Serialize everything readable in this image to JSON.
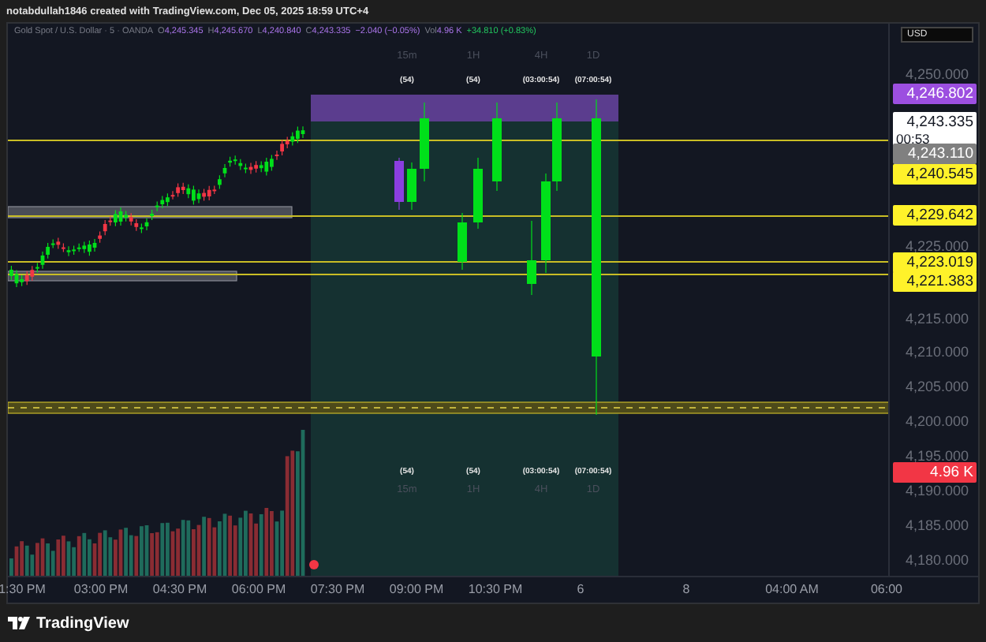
{
  "header": {
    "caption": "notabdullah1846 created with TradingView.com, Dec 05, 2025 18:59 UTC+4"
  },
  "legend": {
    "symbol": "Gold Spot / U.S. Dollar · 5 · OANDA",
    "values": [
      {
        "key": "O",
        "value": "4,245.345"
      },
      {
        "key": "H",
        "value": "4,245.670"
      },
      {
        "key": "L",
        "value": "4,240.840"
      },
      {
        "key": "C",
        "value": "4,243.335"
      }
    ],
    "change": "−2.040 (−0.05%)",
    "volume": {
      "key": "Vol",
      "value": "4.96 K"
    },
    "indicator": "+34.810 (+0.83%)"
  },
  "currency_button": "USD",
  "timeframes_top": [
    {
      "label": "15m",
      "countdown": "(54)"
    },
    {
      "label": "1H",
      "countdown": "(54)"
    },
    {
      "label": "4H",
      "countdown": "(03:00:54)"
    },
    {
      "label": "1D",
      "countdown": "(07:00:54)"
    }
  ],
  "timeframes_bottom": [
    {
      "label": "15m",
      "countdown": "(54)"
    },
    {
      "label": "1H",
      "countdown": "(54)"
    },
    {
      "label": "4H",
      "countdown": "(03:00:54)"
    },
    {
      "label": "1D",
      "countdown": "(07:00:54)"
    }
  ],
  "price_axis": {
    "ticks": [
      "4,250.000",
      "4,225.000",
      "4,215.000",
      "4,210.000",
      "4,205.000",
      "4,200.000",
      "4,195.000",
      "4,190.000",
      "4,185.000",
      "4,180.000"
    ]
  },
  "price_labels": [
    {
      "kind": "high",
      "text": "4,246.802"
    },
    {
      "kind": "last",
      "text": "4,243.335",
      "timer": "00:53"
    },
    {
      "kind": "prev",
      "text": "4,243.110"
    },
    {
      "kind": "level",
      "text": "4,240.545"
    },
    {
      "kind": "level",
      "text": "4,229.642"
    },
    {
      "kind": "level",
      "text": "4,223.019"
    },
    {
      "kind": "level",
      "text": "4,221.383"
    },
    {
      "kind": "volume",
      "text": "4.96 K"
    }
  ],
  "time_axis": {
    "labels": [
      "1:30 PM",
      "03:00 PM",
      "04:30 PM",
      "06:00 PM",
      "07:30 PM",
      "09:00 PM",
      "10:30 PM",
      "6",
      "8",
      "04:00 AM",
      "06:00"
    ]
  },
  "footer": {
    "brand": "TradingView"
  }
}
